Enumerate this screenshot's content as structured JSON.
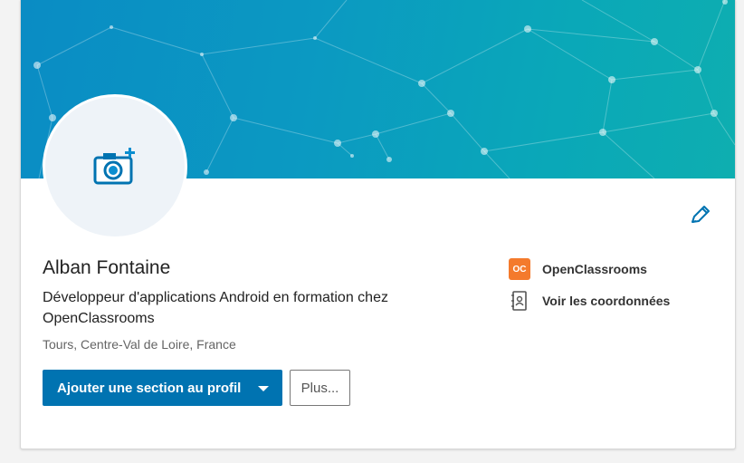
{
  "profile": {
    "name": "Alban Fontaine",
    "headline": "Développeur d'applications Android en formation chez OpenClassrooms",
    "location": "Tours, Centre-Val de Loire, France"
  },
  "actions": {
    "add_section_label": "Ajouter une section au profil",
    "more_label": "Plus..."
  },
  "side": {
    "school": {
      "label": "OpenClassrooms",
      "logo_text": "OC",
      "icon": "openclassrooms-logo",
      "logo_color": "#f47a2c"
    },
    "contact": {
      "label": "Voir les coordonnées",
      "icon": "contact-card-icon"
    }
  },
  "icons": {
    "avatar": "camera-plus-icon",
    "edit": "pencil-icon"
  },
  "colors": {
    "primary": "#0073b1",
    "banner_start": "#0a8cc4",
    "banner_end": "#0eaeb0",
    "text": "#222222",
    "muted": "#646464"
  }
}
